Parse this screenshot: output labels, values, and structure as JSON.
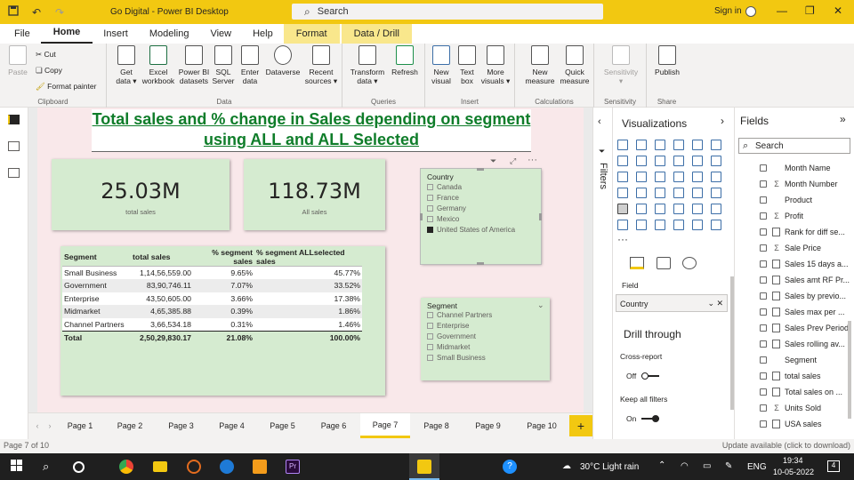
{
  "window": {
    "title": "Go Digital - Power BI Desktop",
    "search_placeholder": "Search",
    "signin": "Sign in"
  },
  "menu": [
    "File",
    "Home",
    "Insert",
    "Modeling",
    "View",
    "Help",
    "Format",
    "Data / Drill"
  ],
  "ribbon": {
    "clipboard": {
      "paste": "Paste",
      "cut": "Cut",
      "copy": "Copy",
      "format_painter": "Format painter",
      "label": "Clipboard"
    },
    "data": {
      "buttons": [
        "Get\ndata ▾",
        "Excel\nworkbook",
        "Power BI\ndatasets",
        "SQL\nServer",
        "Enter\ndata",
        "Dataverse",
        "Recent\nsources ▾"
      ],
      "label": "Data"
    },
    "queries": {
      "buttons": [
        "Transform\ndata ▾",
        "Refresh"
      ],
      "label": "Queries"
    },
    "insert": {
      "buttons": [
        "New\nvisual",
        "Text\nbox",
        "More\nvisuals ▾"
      ],
      "label": "Insert"
    },
    "calculations": {
      "buttons": [
        "New\nmeasure",
        "Quick\nmeasure"
      ],
      "label": "Calculations"
    },
    "sensitivity": {
      "buttons": [
        "Sensitivity\n▾"
      ],
      "label": "Sensitivity"
    },
    "share": {
      "buttons": [
        "Publish"
      ],
      "label": "Share"
    }
  },
  "report": {
    "title": "Total sales and % change in Sales depending on segment using ALL and ALL Selected",
    "card1": {
      "value": "25.03M",
      "label": "total sales"
    },
    "card2": {
      "value": "118.73M",
      "label": "All sales"
    },
    "table": {
      "headers": [
        "Segment",
        "total sales",
        "% segment sales",
        "% segment ALLselected sales"
      ],
      "rows": [
        [
          "Small Business",
          "1,14,56,559.00",
          "9.65%",
          "45.77%"
        ],
        [
          "Government",
          "83,90,746.11",
          "7.07%",
          "33.52%"
        ],
        [
          "Enterprise",
          "43,50,605.00",
          "3.66%",
          "17.38%"
        ],
        [
          "Midmarket",
          "4,65,385.88",
          "0.39%",
          "1.86%"
        ],
        [
          "Channel Partners",
          "3,66,534.18",
          "0.31%",
          "1.46%"
        ]
      ],
      "total": [
        "Total",
        "2,50,29,830.17",
        "21.08%",
        "100.00%"
      ]
    },
    "country_slicer": {
      "title": "Country",
      "items": [
        "Canada",
        "France",
        "Germany",
        "Mexico",
        "United States of America"
      ],
      "selected_index": 4
    },
    "segment_slicer": {
      "title": "Segment",
      "items": [
        "Channel Partners",
        "Enterprise",
        "Government",
        "Midmarket",
        "Small Business"
      ]
    }
  },
  "pages": {
    "tabs": [
      "Page 1",
      "Page 2",
      "Page 3",
      "Page 4",
      "Page 5",
      "Page 6",
      "Page 7",
      "Page 8",
      "Page 9",
      "Page 10"
    ],
    "active": "Page 7",
    "add": "+"
  },
  "filters_label": "Filters",
  "viz": {
    "title": "Visualizations",
    "field_label": "Field",
    "field_value": "Country",
    "drill_title": "Drill through",
    "cross_report": "Cross-report",
    "off": "Off",
    "keep_filters": "Keep all filters",
    "on": "On"
  },
  "fields": {
    "title": "Fields",
    "search_placeholder": "Search",
    "items": [
      {
        "name": "Month Name",
        "type": ""
      },
      {
        "name": "Month Number",
        "type": "Σ"
      },
      {
        "name": "Product",
        "type": ""
      },
      {
        "name": "Profit",
        "type": "Σ"
      },
      {
        "name": "Rank for diff se...",
        "type": "calc"
      },
      {
        "name": "Sale Price",
        "type": "Σ"
      },
      {
        "name": "Sales 15 days a...",
        "type": "calc"
      },
      {
        "name": "Sales amt RF Pr...",
        "type": "calc"
      },
      {
        "name": "Sales by previo...",
        "type": "calc"
      },
      {
        "name": "Sales max per ...",
        "type": "calc"
      },
      {
        "name": "Sales Prev Period",
        "type": "calc"
      },
      {
        "name": "Sales rolling av...",
        "type": "calc"
      },
      {
        "name": "Segment",
        "type": ""
      },
      {
        "name": "total sales",
        "type": "calc"
      },
      {
        "name": "Total sales on ...",
        "type": "calc"
      },
      {
        "name": "Units Sold",
        "type": "Σ"
      },
      {
        "name": "USA sales",
        "type": "calc"
      }
    ]
  },
  "status": {
    "left": "Page 7 of 10",
    "right": "Update available (click to download)"
  },
  "taskbar": {
    "weather": "30°C  Light rain",
    "lang": "ENG",
    "time": "19:34",
    "date": "10-05-2022",
    "notifications": "4"
  },
  "colors": {
    "accent": "#f2c811",
    "title_green": "#0f7d2a",
    "card_bg": "#d5ebd0",
    "page_bg": "#f9e8ea"
  }
}
